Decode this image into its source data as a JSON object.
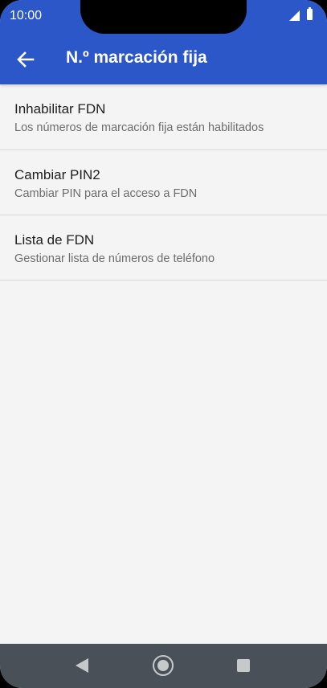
{
  "status_bar": {
    "time": "10:00"
  },
  "app_bar": {
    "title": "N.º marcación fija"
  },
  "items": [
    {
      "title": "Inhabilitar FDN",
      "subtitle": "Los números de marcación fija están habilitados"
    },
    {
      "title": "Cambiar PIN2",
      "subtitle": "Cambiar PIN para el acceso a FDN"
    },
    {
      "title": "Lista de FDN",
      "subtitle": "Gestionar lista de números de teléfono"
    }
  ],
  "colors": {
    "accent": "#2b57c9",
    "background": "#f4f4f4",
    "nav_bar": "#4a5058"
  },
  "icons": {
    "back": "arrow-back-icon",
    "signal": "signal-icon",
    "battery": "battery-icon",
    "nav_back": "nav-back-icon",
    "nav_home": "nav-home-icon",
    "nav_recents": "nav-recents-icon"
  }
}
